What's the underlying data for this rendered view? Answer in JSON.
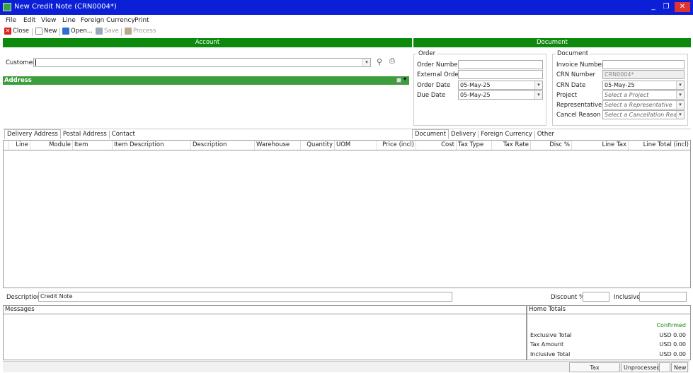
{
  "window": {
    "title": "New Credit Note (CRN0004*)",
    "minimize": "_",
    "restore": "❐",
    "close": "✕"
  },
  "menu": [
    "File",
    "Edit",
    "View",
    "Line",
    "Foreign Currency",
    "Print"
  ],
  "toolbar": {
    "close": "Close",
    "new": "New",
    "open": "Open...",
    "save": "Save",
    "process": "Process"
  },
  "sections": {
    "account": "Account",
    "document": "Document",
    "address": "Address"
  },
  "customer": {
    "label": "Customer",
    "value": ""
  },
  "order": {
    "legend": "Order",
    "order_number_label": "Order Number",
    "order_number": "",
    "external_order_label": "External Order",
    "external_order": "",
    "order_date_label": "Order Date",
    "order_date": "05-May-25",
    "due_date_label": "Due Date",
    "due_date": "05-May-25"
  },
  "document": {
    "legend": "Document",
    "invoice_number_label": "Invoice Number",
    "invoice_number": "",
    "crn_number_label": "CRN Number",
    "crn_number": "CRN0004*",
    "crn_date_label": "CRN Date",
    "crn_date": "05-May-25",
    "project_label": "Project",
    "project_placeholder": "Select a Project",
    "representative_label": "Representative",
    "representative_placeholder": "Select a Representative",
    "cancel_reason_label": "Cancel Reason",
    "cancel_reason_placeholder": "Select a Cancellation Reason"
  },
  "address_tabs": [
    "Delivery Address",
    "Postal Address",
    "Contact"
  ],
  "document_tabs": [
    "Document",
    "Delivery",
    "Foreign Currency",
    "Other"
  ],
  "grid_columns": [
    "Line",
    "Module",
    "Item",
    "Item Description",
    "Description",
    "Warehouse",
    "Quantity",
    "UOM",
    "Price (incl)",
    "Cost",
    "Tax Type",
    "Tax Rate",
    "Disc %",
    "Line Tax",
    "Line Total (incl)"
  ],
  "footer": {
    "description_label": "Description",
    "description": "Credit Note",
    "discount_label": "Discount %",
    "discount": "",
    "inclusive_label": "Inclusive",
    "inclusive": "",
    "messages_label": "Messages",
    "home_totals_label": "Home Totals",
    "status": "Confirmed",
    "exclusive_total_label": "Exclusive Total",
    "exclusive_total": "USD 0.00",
    "tax_amount_label": "Tax Amount",
    "tax_amount": "USD 0.00",
    "inclusive_total_label": "Inclusive Total",
    "inclusive_total": "USD 0.00"
  },
  "statusbar": {
    "tax_mode": "Tax Inclusive(Line)",
    "process_state": "Unprocessed",
    "blank": "",
    "mode": "New"
  },
  "colors": {
    "titlebar": "#0b1fd6",
    "section_green": "#0d8a0d",
    "confirmed": "#0d8a0d"
  }
}
